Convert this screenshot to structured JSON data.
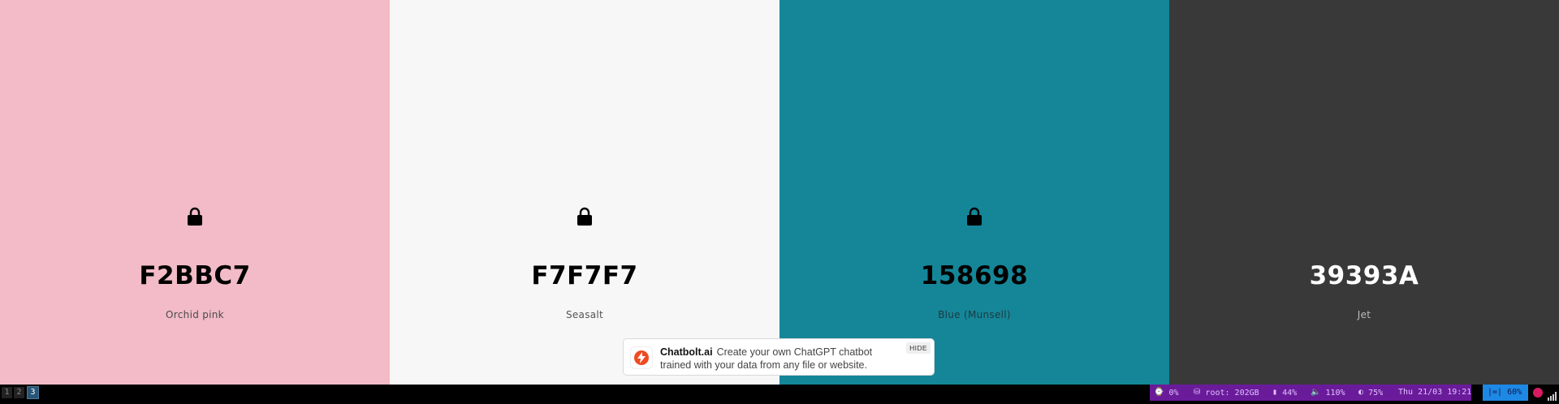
{
  "swatches": [
    {
      "hex": "F2BBC7",
      "name": "Orchid pink",
      "bg": "#F2BBC7",
      "text_color": "#000000",
      "name_color": "#4a4a4a"
    },
    {
      "hex": "F7F7F7",
      "name": "Seasalt",
      "bg": "#F7F7F7",
      "text_color": "#000000",
      "name_color": "#555555"
    },
    {
      "hex": "158698",
      "name": "Blue (Munsell)",
      "bg": "#158698",
      "text_color": "#000000",
      "name_color": "#1c3a40"
    },
    {
      "hex": "39393A",
      "name": "Jet",
      "bg": "#39393A",
      "text_color": "#ffffff",
      "name_color": "#bdbdbd"
    }
  ],
  "ad": {
    "brand": "Chatbolt.ai",
    "text": "Create your own ChatGPT chatbot trained with your data from any file or website.",
    "hide_label": "HIDE"
  },
  "taskbar": {
    "workspaces": [
      "1",
      "2",
      "3"
    ],
    "active_workspace": "3",
    "cpu": "0%",
    "disk": "root: 202GB",
    "memory": "44%",
    "volume": "110%",
    "battery": "75%",
    "datetime": "Thu 21/03 19:21",
    "brightness": "60%",
    "brightness_prefix": "|=|"
  }
}
